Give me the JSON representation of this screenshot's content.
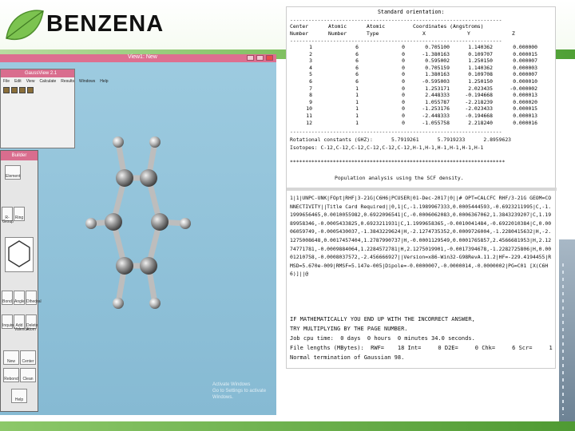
{
  "slide": {
    "title": "BENZENA"
  },
  "gaussview": {
    "window_title": "View1: New",
    "mini_title": "GaussView 2.1",
    "mini_menu": [
      "File",
      "Edit",
      "View",
      "Calculate",
      "Results",
      "Windows",
      "Help"
    ],
    "builder_title": "Builder",
    "builder_buttons": [
      "Element",
      "R-Group",
      "Ring",
      "Bond",
      "Angle",
      "Dihedral",
      "Inquire",
      "Add Valence",
      "Delete Atom",
      "New",
      "Center",
      "Rebond",
      "Clean",
      "Help"
    ],
    "watermark": [
      "Activate Windows",
      "Go to Settings to activate Windows."
    ]
  },
  "output": {
    "orientation_title": "Standard orientation:",
    "header_line1": [
      "Center",
      "Atomic",
      "Atomic",
      "Coordinates (Angstroms)"
    ],
    "header_line2": [
      "Number",
      "Number",
      "Type",
      "X",
      "Y",
      "Z"
    ],
    "atoms": [
      [
        "1",
        "6",
        "0",
        "0.705100",
        "1.140362",
        "0.000000"
      ],
      [
        "2",
        "6",
        "0",
        "-1.380163",
        "0.109707",
        "0.000015"
      ],
      [
        "3",
        "6",
        "0",
        "0.595002",
        "1.250150",
        "0.000007"
      ],
      [
        "4",
        "6",
        "0",
        "0.705159",
        "1.140362",
        "0.000003"
      ],
      [
        "5",
        "6",
        "0",
        "1.380163",
        "0.109708",
        "0.000007"
      ],
      [
        "6",
        "6",
        "0",
        "-0.595003",
        "1.250150",
        "0.000010"
      ],
      [
        "7",
        "1",
        "0",
        "1.253171",
        "2.023435",
        "-0.000002"
      ],
      [
        "8",
        "1",
        "0",
        "2.448333",
        "-0.194668",
        "0.000013"
      ],
      [
        "9",
        "1",
        "0",
        "1.055787",
        "-2.218239",
        "0.000020"
      ],
      [
        "10",
        "1",
        "0",
        "-1.253176",
        "-2.023433",
        "0.000015"
      ],
      [
        "11",
        "1",
        "0",
        "-2.448333",
        "-0.194668",
        "0.000013"
      ],
      [
        "12",
        "1",
        "0",
        "-1.055758",
        "2.218240",
        "0.000016"
      ]
    ],
    "dashes": "---------------------------------------------------------------------",
    "rotational": "Rotational constants (GHZ):      5.7919261      5.7919233      2.8959623",
    "isotopes": "Isotopes: C-12,C-12,C-12,C-12,C-12,C-12,H-1,H-1,H-1,H-1,H-1,H-1",
    "stars": "**********************************************************************",
    "population": "Population analysis using the SCF density.",
    "archive": "1|1|UNPC-UNK|FOpt|RHF|3-21G|C6H6|PCUSER|01-Dec-2017|0||# OPT=CALCFC RHF/3-21G GEOM=CONNECTIVITY||Title Card Required||0,1|C,-1.1989967333,0.0005444593,-0.6923211995|C,-1.1999656465,0.0010055982,0.6922096541|C,-0.0006062083,0.0006367062,1.3843239207|C,1.1989958346,-0.0005433825,0.6923211931|C,1.1999658365,-0.0010041484,-0.6922010384|C,0.0006059749,-0.0005430037,-1.3843229624|H,-2.1274735352,0.0009726004,-1.2280415632|H,-2.1275008648,0.0017457404,1.2787990737|H,-0.0001129549,0.0001765857,2.4566681953|H,2.1274771781,-0.0009884064,1.2284572781|H,2.1275019901,-0.0017394678,-1.2282725806|H,0.0001210758,-0.0008037572,-2.456666927||Version=x86-Win32-G98RevA.11.2|HF=-229.4194455|RMSD=5.670e-009|RMSF=5.147e-005|Dipole=-0.0000007,-0.0000014,-0.0000002|PG=C01 [X(C6H6)]||@",
    "tail": [
      "IF MATHEMATICALLY YOU END UP WITH THE INCORRECT ANSWER,",
      "TRY MULTIPLYING BY THE PAGE NUMBER.",
      "Job cpu time:  0 days  0 hours  0 minutes 34.0 seconds.",
      "File lengths (MBytes):  RWF=    18 Int=     0 D2E=     0 Chk=     6 Scr=     1",
      "Normal termination of Gaussian 98."
    ]
  }
}
